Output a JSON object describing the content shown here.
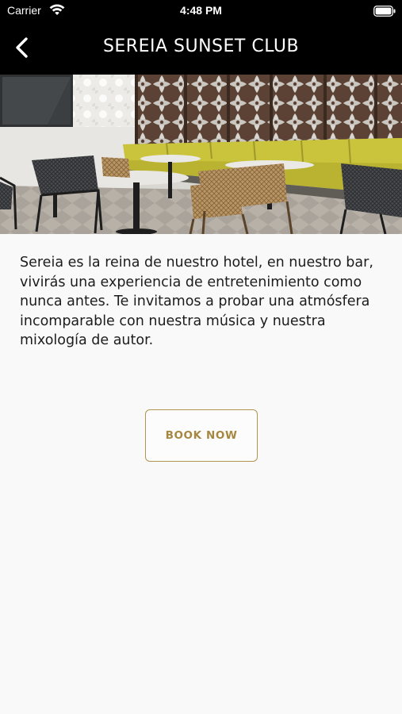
{
  "status_bar": {
    "carrier": "Carrier",
    "time": "4:48 PM",
    "wifi_icon": "wifi-icon",
    "battery_icon": "battery-icon"
  },
  "nav": {
    "back_icon": "chevron-left-icon",
    "title": "SEREIA SUNSET CLUB"
  },
  "hero": {
    "image": "hotel-bar-lounge-photo",
    "colors": {
      "sofa": "#b9b331",
      "screen": "#8a4a2d"
    }
  },
  "content": {
    "description": "Sereia es la reina de nuestro hotel, en nuestro bar, vivirás una experiencia de entretenimiento como nunca antes. Te invitamos a probar una atmósfera incomparable con nuestra música y nuestra mixología de autor."
  },
  "actions": {
    "book_label": "BOOK NOW",
    "accent_color": "#b0954f"
  }
}
